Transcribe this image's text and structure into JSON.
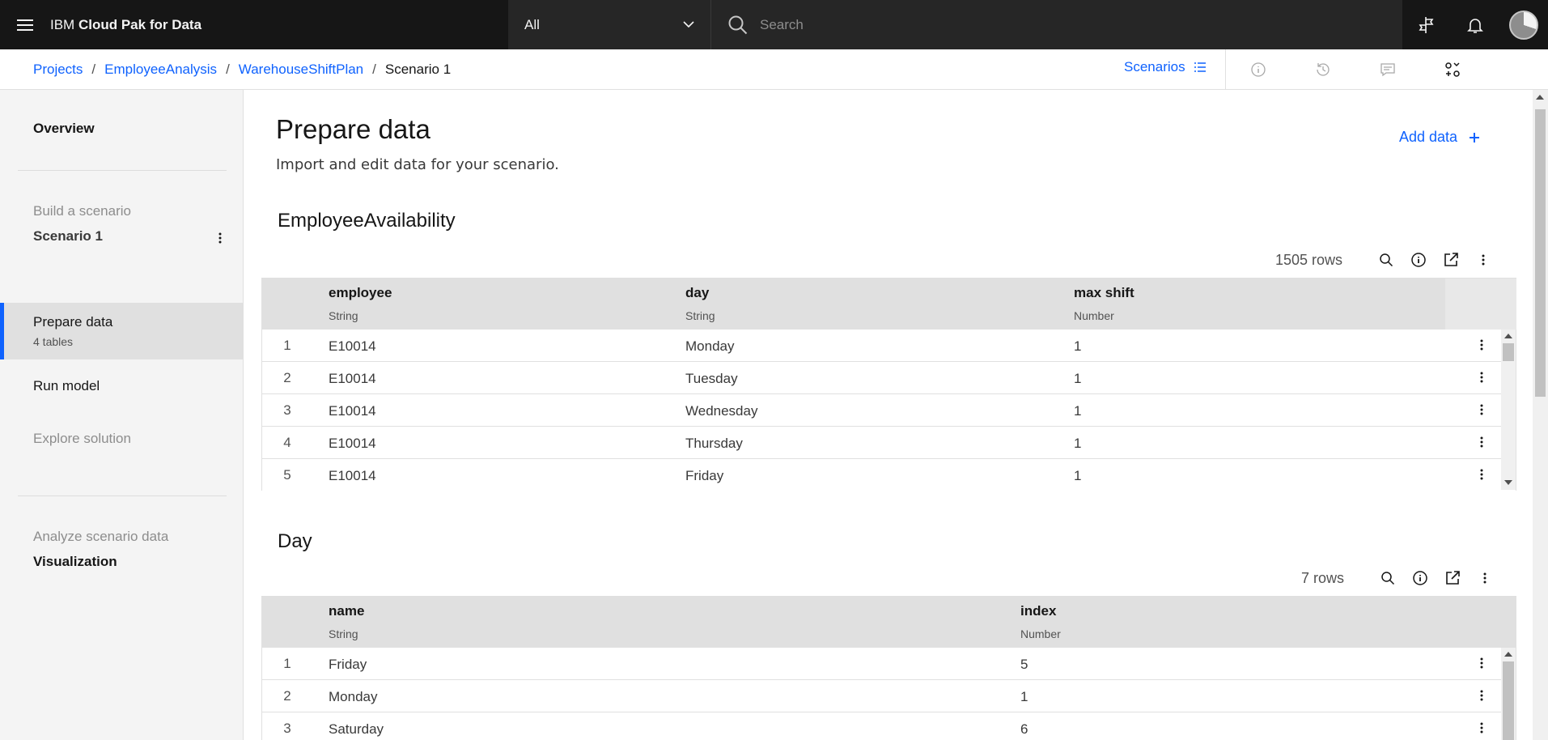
{
  "topbar": {
    "brand_prefix": "IBM",
    "brand_name": "Cloud Pak for Data",
    "scope_value": "All",
    "search_placeholder": "Search"
  },
  "breadcrumb": {
    "items": [
      "Projects",
      "EmployeeAnalysis",
      "WarehouseShiftPlan"
    ],
    "current": "Scenario 1",
    "separator": "/",
    "scenarios_label": "Scenarios"
  },
  "sidebar": {
    "overview": "Overview",
    "build_label": "Build a scenario",
    "scenario_name": "Scenario 1",
    "prepare_data": "Prepare data",
    "prepare_data_sub": "4 tables",
    "run_model": "Run model",
    "explore_solution": "Explore solution",
    "analyze_label": "Analyze scenario data",
    "visualization": "Visualization"
  },
  "main": {
    "title": "Prepare data",
    "subtitle": "Import and edit data for your scenario.",
    "add_data": "Add data",
    "tables": [
      {
        "name": "EmployeeAvailability",
        "row_count": "1505 rows",
        "columns": [
          {
            "name": "employee",
            "type": "String"
          },
          {
            "name": "day",
            "type": "String"
          },
          {
            "name": "max shift",
            "type": "Number"
          }
        ],
        "rows": [
          [
            "1",
            "E10014",
            "Monday",
            "1"
          ],
          [
            "2",
            "E10014",
            "Tuesday",
            "1"
          ],
          [
            "3",
            "E10014",
            "Wednesday",
            "1"
          ],
          [
            "4",
            "E10014",
            "Thursday",
            "1"
          ],
          [
            "5",
            "E10014",
            "Friday",
            "1"
          ]
        ]
      },
      {
        "name": "Day",
        "row_count": "7 rows",
        "columns": [
          {
            "name": "name",
            "type": "String"
          },
          {
            "name": "index",
            "type": "Number"
          }
        ],
        "rows": [
          [
            "1",
            "Friday",
            "5"
          ],
          [
            "2",
            "Monday",
            "1"
          ],
          [
            "3",
            "Saturday",
            "6"
          ]
        ]
      }
    ]
  },
  "colors": {
    "accent": "#0f62fe",
    "topbar_bg": "#161616",
    "header_bg": "#e0e0e0",
    "sidebar_bg": "#f4f4f4"
  }
}
